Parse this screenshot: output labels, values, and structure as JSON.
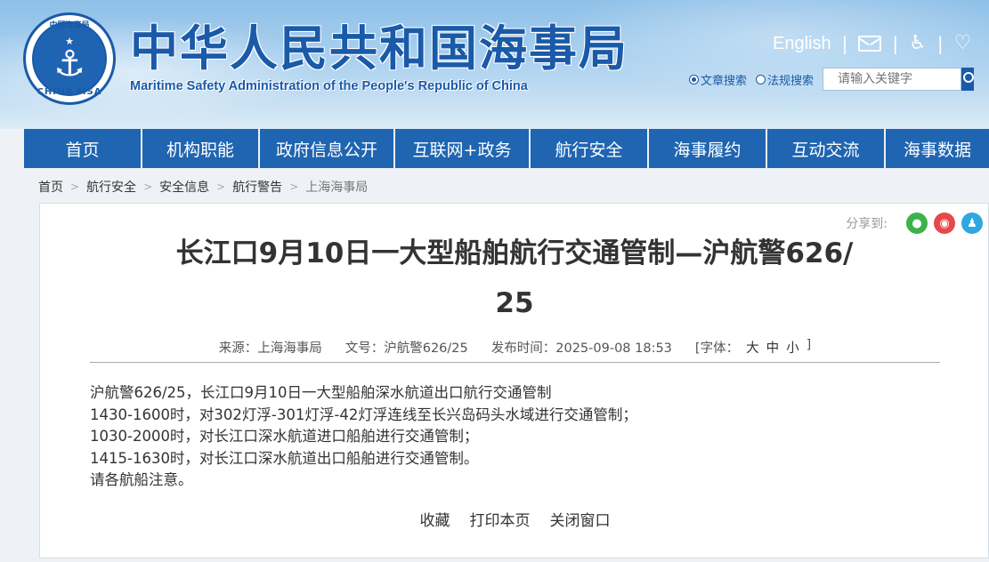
{
  "header": {
    "logo": {
      "ring_top": "中国海事局",
      "ring_bottom": "CHINA MSA",
      "icon": "anchor-icon"
    },
    "title": "中华人民共和国海事局",
    "subtitle": "Maritime Safety Administration of the People's Republic of China",
    "english_link": "English",
    "icons": [
      "mail-icon",
      "accessibility-icon",
      "elder-care-icon"
    ],
    "search": {
      "options": [
        {
          "label": "文章搜索",
          "selected": true
        },
        {
          "label": "法规搜索",
          "selected": false
        }
      ],
      "placeholder": "请输入关键字"
    }
  },
  "nav": {
    "items": [
      "首页",
      "机构职能",
      "政府信息公开",
      "互联网+政务",
      "航行安全",
      "海事履约",
      "互动交流",
      "海事数据"
    ]
  },
  "breadcrumb": [
    "首页",
    "航行安全",
    "安全信息",
    "航行警告",
    "上海海事局"
  ],
  "share": {
    "label": "分享到:",
    "targets": [
      "wechat-icon",
      "weibo-icon",
      "qq-icon"
    ]
  },
  "article": {
    "title_line1": "长江口9月10日一大型船舶航行交通管制—沪航警626/",
    "title_line2": "25",
    "meta": {
      "source": "来源：上海海事局",
      "doc_no": "文号：沪航警626/25",
      "published": "发布时间：2025-09-08 18:53",
      "font_label": "[字体：",
      "font_large": "大",
      "font_medium": "中",
      "font_small": "小",
      "font_close": "]"
    },
    "body": [
      "沪航警626/25，长江口9月10日一大型船舶深水航道出口航行交通管制",
      "1430-1600时，对302灯浮-301灯浮-42灯浮连线至长兴岛码头水域进行交通管制；",
      "1030-2000时，对长江口深水航道进口船舶进行交通管制；",
      "1415-1630时，对长江口深水航道出口船舶进行交通管制。",
      "请各航船注意。"
    ],
    "actions": {
      "favorite": "收藏",
      "print": "打印本页",
      "close": "关闭窗口"
    }
  }
}
